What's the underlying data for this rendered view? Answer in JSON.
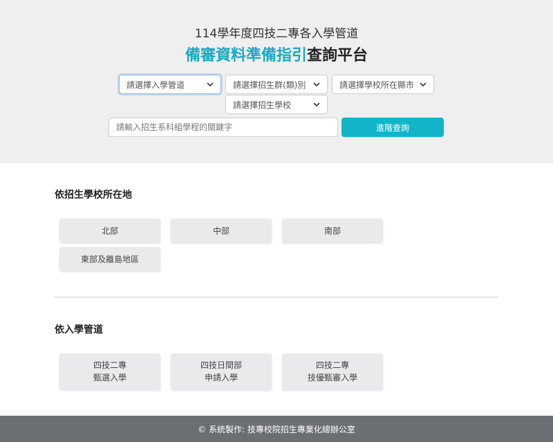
{
  "header": {
    "title_line1": "114學年度四技二專各入學管道",
    "title_accent": "備審資料準備指引",
    "title_plain": "查詢平台",
    "colors": {
      "accent": "#1aa9c2",
      "button": "#12b5c8",
      "header_bg": "#efefef",
      "footer_bg": "#6b6f74"
    }
  },
  "filters": {
    "channel": {
      "label": "請選擇入學管道",
      "icon": "chevron-down-icon"
    },
    "group": {
      "label": "請選擇招生群(類)別",
      "icon": "chevron-down-icon"
    },
    "county": {
      "label": "請選擇學校所在縣市",
      "icon": "chevron-down-icon"
    },
    "school": {
      "label": "請選擇招生學校",
      "icon": "chevron-down-icon"
    },
    "keyword": {
      "placeholder": "請輸入招生系科組學程的關鍵字",
      "value": ""
    },
    "search_label": "進階查詢"
  },
  "location_section": {
    "title": "依招生學校所在地",
    "items": [
      "北部",
      "中部",
      "南部",
      "東部及離島地區"
    ]
  },
  "channel_section": {
    "title": "依入學管道",
    "items": [
      {
        "line1": "四技二專",
        "line2": "甄選入學"
      },
      {
        "line1": "四技日間部",
        "line2": "申請入學"
      },
      {
        "line1": "四技二專",
        "line2": "技優甄審入學"
      }
    ]
  },
  "footer": {
    "text": "© 系統製作: 技專校院招生專業化總辦公室"
  }
}
